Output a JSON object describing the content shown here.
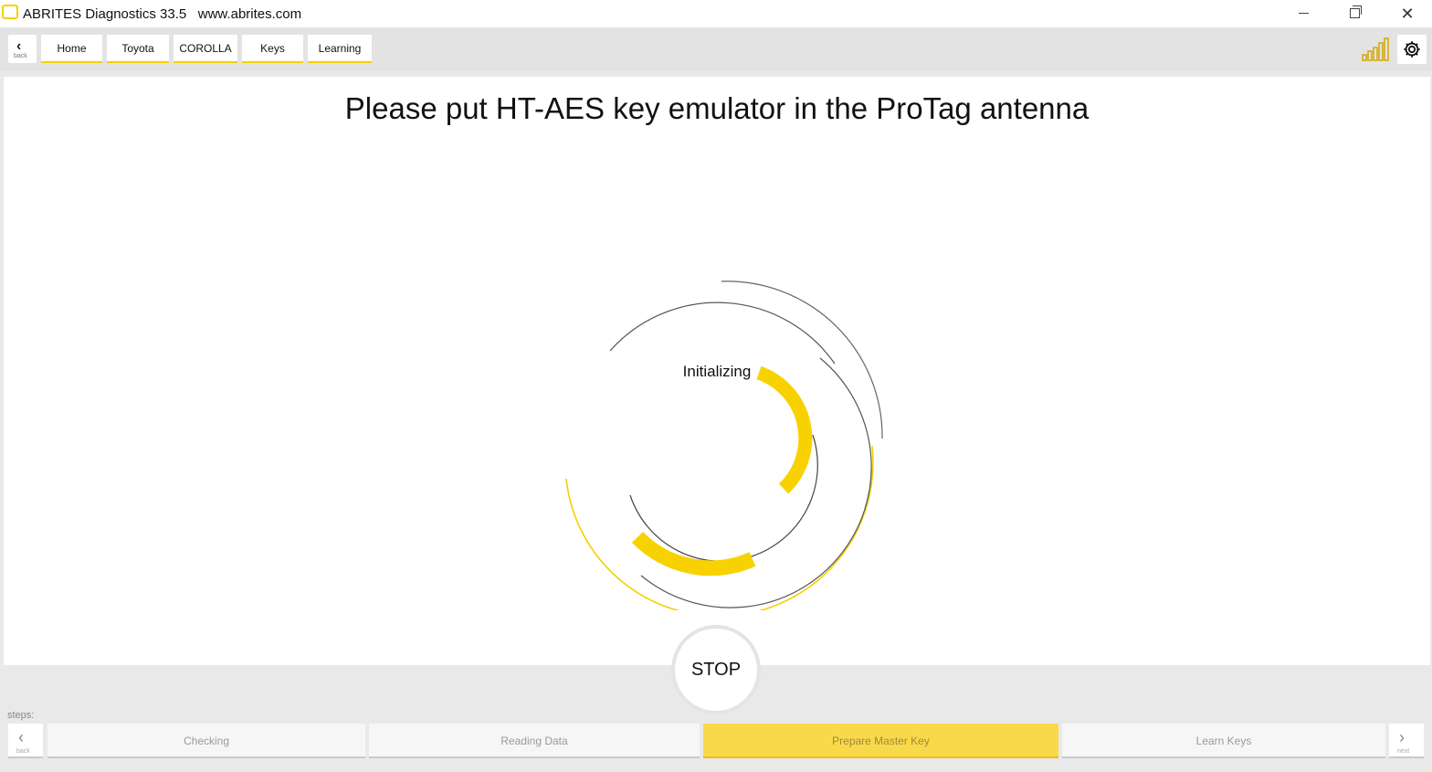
{
  "window": {
    "title": "ABRITES Diagnostics 33.5",
    "url": "www.abrites.com",
    "minimize_icon": "minimize-icon",
    "maximize_icon": "restore-icon",
    "close_icon": "close-icon",
    "close_glyph": "✕"
  },
  "toolbar": {
    "back_glyph": "‹",
    "back_label": "back",
    "breadcrumbs": [
      "Home",
      "Toyota",
      "COROLLA",
      "Keys",
      "Learning"
    ],
    "signal_icon": "signal-strength-icon",
    "settings_icon": "gear-icon"
  },
  "main": {
    "prompt": "Please put HT-AES key emulator in the ProTag antenna",
    "status": "Initializing",
    "spinner_accent": "#f5d000",
    "spinner_line": "#555555"
  },
  "stop_button": {
    "label": "STOP"
  },
  "steps": {
    "label": "steps:",
    "back_glyph": "‹",
    "back_label": "back",
    "next_glyph": "›",
    "next_label": "next",
    "items": [
      {
        "label": "Checking",
        "active": false
      },
      {
        "label": "Reading Data",
        "active": false
      },
      {
        "label": "Prepare Master Key",
        "active": true
      },
      {
        "label": "Learn Keys",
        "active": false
      }
    ],
    "active_color": "#f9d94a"
  }
}
